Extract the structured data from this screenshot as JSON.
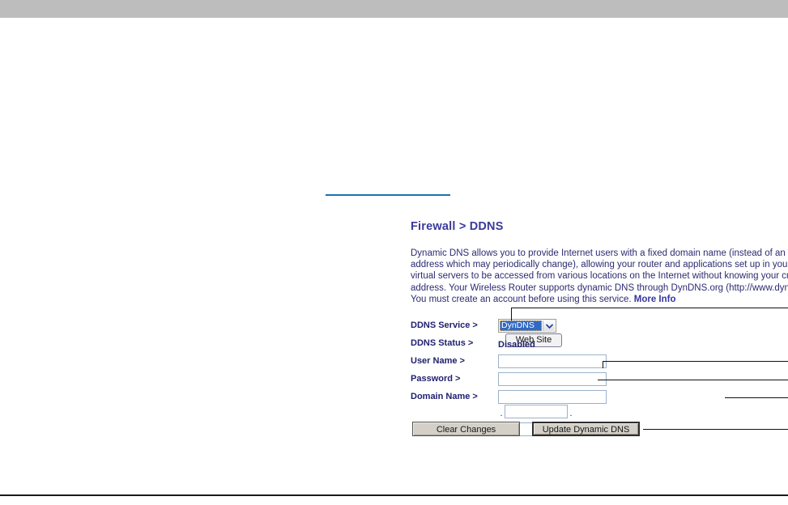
{
  "page": {
    "title": "Firewall > DDNS",
    "intro_paragraph": "Dynamic DNS allows you to provide Internet users with a fixed domain name (instead of an IP address which may periodically change), allowing your router and applications set up in your router as virtual servers to be accessed from various locations on the Internet without knowing your current IP address. Your Wireless Router supports dynamic DNS through DynDNS.org (http://www.dyndns.org). You must create an account before using this service. ",
    "more_info_label": "More Info"
  },
  "form": {
    "ddns_service": {
      "label": "DDNS Service >",
      "selected_option": "DynDNS",
      "website_button_label": "Web Site"
    },
    "ddns_status": {
      "label": "DDNS Status >",
      "value": "Disabled"
    },
    "user_name": {
      "label": "User Name >",
      "value": "",
      "placeholder": ""
    },
    "password": {
      "label": "Password >",
      "value": "",
      "placeholder": ""
    },
    "domain_name": {
      "label": "Domain Name >",
      "part1": "",
      "part2": "",
      "part3": "",
      "separator": "."
    }
  },
  "actions": {
    "clear_label": "Clear Changes",
    "update_label": "Update Dynamic DNS"
  },
  "colors": {
    "title_blue": "#3a3a9c",
    "label_navy": "#1f1f6e",
    "rule_blue": "#1d72b0",
    "select_highlight": "#316ac5",
    "top_bar_gray": "#bdbdbd",
    "input_border": "#9bb2c9",
    "button_face": "#d4d0c8"
  }
}
